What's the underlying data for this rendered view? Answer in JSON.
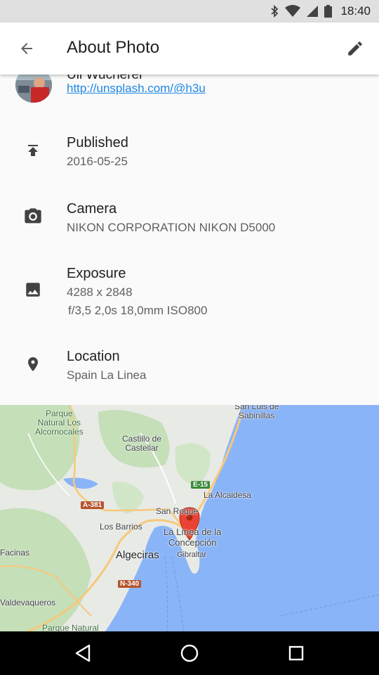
{
  "status_bar": {
    "time": "18:40",
    "icons": [
      "bluetooth-icon",
      "wifi-icon",
      "signal-icon",
      "battery-icon"
    ]
  },
  "app_bar": {
    "title": "About Photo",
    "back_icon": "arrow-back-icon",
    "edit_icon": "pencil-icon"
  },
  "author": {
    "name": "Uli Wucherer",
    "link": "http://unsplash.com/@h3u"
  },
  "details": [
    {
      "icon": "publish-icon",
      "title": "Published",
      "lines": [
        "2016-05-25"
      ]
    },
    {
      "icon": "camera-icon",
      "title": "Camera",
      "lines": [
        "NIKON CORPORATION NIKON D5000"
      ]
    },
    {
      "icon": "image-icon",
      "title": "Exposure",
      "lines": [
        "4288 x 2848",
        "f/3,5 2,0s 18,0mm ISO800"
      ]
    },
    {
      "icon": "location-pin-icon",
      "title": "Location",
      "lines": [
        "Spain La Linea"
      ]
    }
  ],
  "map": {
    "labels": {
      "parque_natural_los_alcornocales": "Parque\nNatural Los\nAlcornocales",
      "san_luis_de_sabinillas": "San Luis de\nSabinillas",
      "castillo_de_castellar": "Castillo de\nCastellar",
      "e15": "E-15",
      "la_alcaidesa": "La Alcaidesa",
      "a381": "A-381",
      "san_roque": "San Roque",
      "los_barrios": "Los Barrios",
      "la_linea": "La Línea de la\nConcepción",
      "algeciras": "Algeciras",
      "gibraltar": "Gibraltar",
      "facinas": "Facinas",
      "n340": "N-340",
      "valdevaqueros": "Valdevaqueros",
      "parque_natural_bottom": "Parque Natural"
    },
    "colors": {
      "sea": "#8ab4f8",
      "land": "#e8eae6",
      "forest": "#c5dfb9",
      "road": "#f7c87a",
      "pin": "#ea4335"
    }
  },
  "nav_bar": {
    "back_icon": "nav-back-icon",
    "home_icon": "nav-home-icon",
    "recents_icon": "nav-recents-icon"
  }
}
